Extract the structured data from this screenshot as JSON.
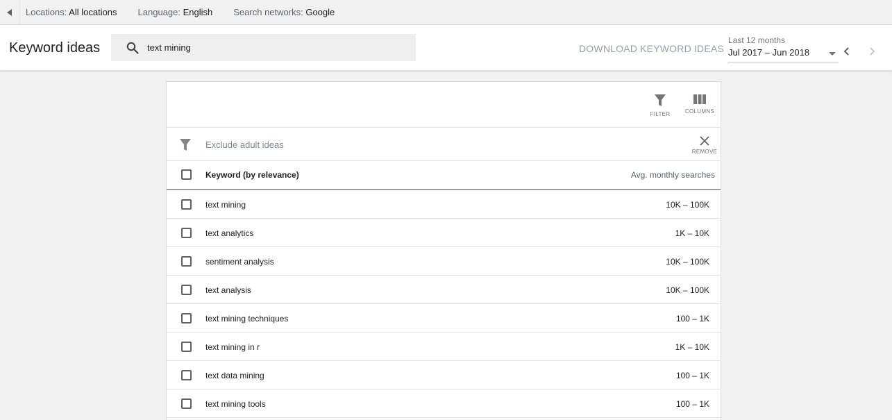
{
  "topbar": {
    "locations_label": "Locations:",
    "locations_value": "All locations",
    "language_label": "Language:",
    "language_value": "English",
    "networks_label": "Search networks:",
    "networks_value": "Google"
  },
  "header": {
    "title": "Keyword ideas",
    "search_value": "text mining",
    "download_label": "DOWNLOAD KEYWORD IDEAS",
    "period_label": "Last 12 months",
    "period_range": "Jul 2017 – Jun 2018"
  },
  "tools": {
    "filter_label": "FILTER",
    "columns_label": "COLUMNS"
  },
  "filter": {
    "text": "Exclude adult ideas",
    "remove_label": "REMOVE"
  },
  "table": {
    "headers": {
      "keyword": "Keyword (by relevance)",
      "searches": "Avg. monthly searches"
    },
    "rows": [
      {
        "keyword": "text mining",
        "searches": "10K – 100K"
      },
      {
        "keyword": "text analytics",
        "searches": "1K – 10K"
      },
      {
        "keyword": "sentiment analysis",
        "searches": "10K – 100K"
      },
      {
        "keyword": "text analysis",
        "searches": "10K – 100K"
      },
      {
        "keyword": "text mining techniques",
        "searches": "100 – 1K"
      },
      {
        "keyword": "text mining in r",
        "searches": "1K – 10K"
      },
      {
        "keyword": "text data mining",
        "searches": "100 – 1K"
      },
      {
        "keyword": "text mining tools",
        "searches": "100 – 1K"
      }
    ]
  },
  "colors": {
    "background": "#f1f1f1",
    "download_text": "#9aa0a6",
    "icon_grey": "#757575"
  },
  "icons": {
    "back": "caret-left-icon",
    "search": "search-icon",
    "dropdown": "caret-down-icon",
    "prev": "chevron-left-icon",
    "next": "chevron-right-icon",
    "filter": "funnel-icon",
    "columns": "columns-icon",
    "remove": "close-icon"
  }
}
